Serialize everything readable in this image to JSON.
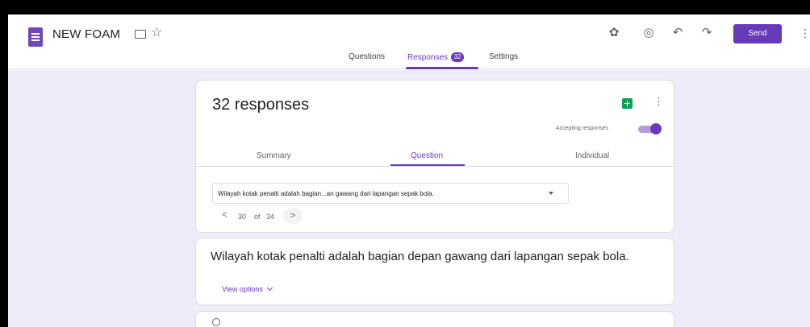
{
  "app": {
    "title": "NEW FOAM"
  },
  "header_actions": {
    "send_label": "Send"
  },
  "tabs": [
    {
      "label": "Questions"
    },
    {
      "label": "Responses",
      "badge": "32"
    },
    {
      "label": "Settings"
    }
  ],
  "responses": {
    "title": "32 responses",
    "accepting_label": "Accepting responses",
    "accepting": true,
    "subtabs": [
      "Summary",
      "Question",
      "Individual"
    ],
    "question_selector_value": "Wilayah kotak penalti adalah bagian...an gawang dari lapangan sepak bola.",
    "pager": {
      "prev": "<",
      "current": "30",
      "of": "of",
      "total": "34",
      "next": ">"
    }
  },
  "question": {
    "text": "Wilayah kotak penalti adalah bagian depan gawang dari lapangan sepak bola.",
    "view_options_label": "View options"
  },
  "colors": {
    "accent": "#673ab7",
    "background": "#f0ebf8",
    "sheets": "#0f9d58"
  }
}
